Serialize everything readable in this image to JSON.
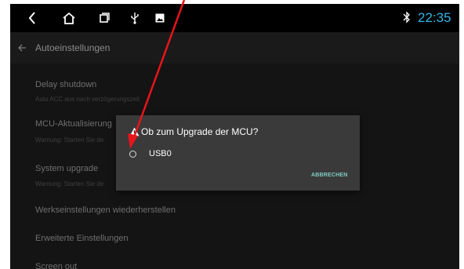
{
  "statusbar": {
    "icons": [
      "back-icon",
      "home-icon",
      "recent-apps-icon",
      "usb-icon",
      "image-icon",
      "bluetooth-icon"
    ],
    "time": "22:35",
    "time_color": "#33b5e5"
  },
  "appbar": {
    "title": "Autoeinstellungen"
  },
  "settings": {
    "items": [
      {
        "title": "Delay shutdown",
        "subtitle": "Auto ACC aus nach verzögerungszeit"
      },
      {
        "title": "MCU-Aktualisierung",
        "subtitle": "Warnung: Starten Sie de"
      },
      {
        "title": "System upgrade",
        "subtitle": "Warnung: Starten Sie de"
      },
      {
        "title": "Werkseinstellungen wiederherstellen"
      },
      {
        "title": "Erweiterte Einstellungen"
      },
      {
        "title": "Screen out"
      }
    ]
  },
  "dialog": {
    "title": "Ob zum Upgrade der MCU?",
    "options": [
      {
        "label": "USB0",
        "selected": false
      }
    ],
    "cancel_label": "ABBRECHEN",
    "accent_color": "#80cbc4"
  },
  "annotation": {
    "arrow_color": "#e8141b"
  }
}
